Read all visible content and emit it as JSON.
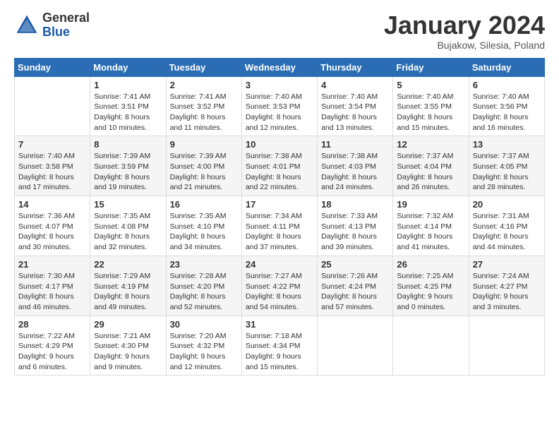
{
  "logo": {
    "general": "General",
    "blue": "Blue"
  },
  "title": "January 2024",
  "subtitle": "Bujakow, Silesia, Poland",
  "days_header": [
    "Sunday",
    "Monday",
    "Tuesday",
    "Wednesday",
    "Thursday",
    "Friday",
    "Saturday"
  ],
  "weeks": [
    [
      {
        "day": "",
        "info": ""
      },
      {
        "day": "1",
        "info": "Sunrise: 7:41 AM\nSunset: 3:51 PM\nDaylight: 8 hours\nand 10 minutes."
      },
      {
        "day": "2",
        "info": "Sunrise: 7:41 AM\nSunset: 3:52 PM\nDaylight: 8 hours\nand 11 minutes."
      },
      {
        "day": "3",
        "info": "Sunrise: 7:40 AM\nSunset: 3:53 PM\nDaylight: 8 hours\nand 12 minutes."
      },
      {
        "day": "4",
        "info": "Sunrise: 7:40 AM\nSunset: 3:54 PM\nDaylight: 8 hours\nand 13 minutes."
      },
      {
        "day": "5",
        "info": "Sunrise: 7:40 AM\nSunset: 3:55 PM\nDaylight: 8 hours\nand 15 minutes."
      },
      {
        "day": "6",
        "info": "Sunrise: 7:40 AM\nSunset: 3:56 PM\nDaylight: 8 hours\nand 16 minutes."
      }
    ],
    [
      {
        "day": "7",
        "info": "Sunrise: 7:40 AM\nSunset: 3:58 PM\nDaylight: 8 hours\nand 17 minutes."
      },
      {
        "day": "8",
        "info": "Sunrise: 7:39 AM\nSunset: 3:59 PM\nDaylight: 8 hours\nand 19 minutes."
      },
      {
        "day": "9",
        "info": "Sunrise: 7:39 AM\nSunset: 4:00 PM\nDaylight: 8 hours\nand 21 minutes."
      },
      {
        "day": "10",
        "info": "Sunrise: 7:38 AM\nSunset: 4:01 PM\nDaylight: 8 hours\nand 22 minutes."
      },
      {
        "day": "11",
        "info": "Sunrise: 7:38 AM\nSunset: 4:03 PM\nDaylight: 8 hours\nand 24 minutes."
      },
      {
        "day": "12",
        "info": "Sunrise: 7:37 AM\nSunset: 4:04 PM\nDaylight: 8 hours\nand 26 minutes."
      },
      {
        "day": "13",
        "info": "Sunrise: 7:37 AM\nSunset: 4:05 PM\nDaylight: 8 hours\nand 28 minutes."
      }
    ],
    [
      {
        "day": "14",
        "info": "Sunrise: 7:36 AM\nSunset: 4:07 PM\nDaylight: 8 hours\nand 30 minutes."
      },
      {
        "day": "15",
        "info": "Sunrise: 7:35 AM\nSunset: 4:08 PM\nDaylight: 8 hours\nand 32 minutes."
      },
      {
        "day": "16",
        "info": "Sunrise: 7:35 AM\nSunset: 4:10 PM\nDaylight: 8 hours\nand 34 minutes."
      },
      {
        "day": "17",
        "info": "Sunrise: 7:34 AM\nSunset: 4:11 PM\nDaylight: 8 hours\nand 37 minutes."
      },
      {
        "day": "18",
        "info": "Sunrise: 7:33 AM\nSunset: 4:13 PM\nDaylight: 8 hours\nand 39 minutes."
      },
      {
        "day": "19",
        "info": "Sunrise: 7:32 AM\nSunset: 4:14 PM\nDaylight: 8 hours\nand 41 minutes."
      },
      {
        "day": "20",
        "info": "Sunrise: 7:31 AM\nSunset: 4:16 PM\nDaylight: 8 hours\nand 44 minutes."
      }
    ],
    [
      {
        "day": "21",
        "info": "Sunrise: 7:30 AM\nSunset: 4:17 PM\nDaylight: 8 hours\nand 46 minutes."
      },
      {
        "day": "22",
        "info": "Sunrise: 7:29 AM\nSunset: 4:19 PM\nDaylight: 8 hours\nand 49 minutes."
      },
      {
        "day": "23",
        "info": "Sunrise: 7:28 AM\nSunset: 4:20 PM\nDaylight: 8 hours\nand 52 minutes."
      },
      {
        "day": "24",
        "info": "Sunrise: 7:27 AM\nSunset: 4:22 PM\nDaylight: 8 hours\nand 54 minutes."
      },
      {
        "day": "25",
        "info": "Sunrise: 7:26 AM\nSunset: 4:24 PM\nDaylight: 8 hours\nand 57 minutes."
      },
      {
        "day": "26",
        "info": "Sunrise: 7:25 AM\nSunset: 4:25 PM\nDaylight: 9 hours\nand 0 minutes."
      },
      {
        "day": "27",
        "info": "Sunrise: 7:24 AM\nSunset: 4:27 PM\nDaylight: 9 hours\nand 3 minutes."
      }
    ],
    [
      {
        "day": "28",
        "info": "Sunrise: 7:22 AM\nSunset: 4:29 PM\nDaylight: 9 hours\nand 6 minutes."
      },
      {
        "day": "29",
        "info": "Sunrise: 7:21 AM\nSunset: 4:30 PM\nDaylight: 9 hours\nand 9 minutes."
      },
      {
        "day": "30",
        "info": "Sunrise: 7:20 AM\nSunset: 4:32 PM\nDaylight: 9 hours\nand 12 minutes."
      },
      {
        "day": "31",
        "info": "Sunrise: 7:18 AM\nSunset: 4:34 PM\nDaylight: 9 hours\nand 15 minutes."
      },
      {
        "day": "",
        "info": ""
      },
      {
        "day": "",
        "info": ""
      },
      {
        "day": "",
        "info": ""
      }
    ]
  ]
}
